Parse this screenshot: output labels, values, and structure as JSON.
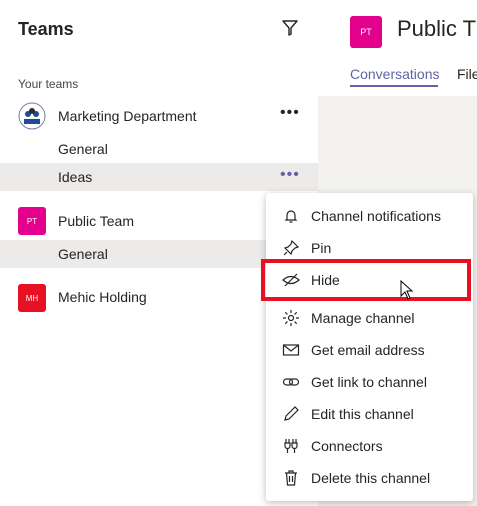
{
  "sidebar": {
    "title": "Teams",
    "section_label": "Your teams",
    "teams": [
      {
        "name": "Marketing Department",
        "channels": [
          "General",
          "Ideas"
        ]
      },
      {
        "name": "Public Team",
        "avatar_text": "PT",
        "avatar_color": "#e3008c",
        "channels": [
          "General"
        ]
      },
      {
        "name": "Mehic Holding",
        "avatar_text": "MH",
        "avatar_color": "#e81123"
      }
    ]
  },
  "header": {
    "avatar_text": "PT",
    "title": "Public T",
    "tabs": [
      "Conversations",
      "File"
    ]
  },
  "context_menu": {
    "items": [
      {
        "label": "Channel notifications",
        "icon": "bell-icon"
      },
      {
        "label": "Pin",
        "icon": "pin-icon"
      },
      {
        "label": "Hide",
        "icon": "eye-slash-icon"
      },
      {
        "label": "Manage channel",
        "icon": "gear-icon"
      },
      {
        "label": "Get email address",
        "icon": "mail-icon"
      },
      {
        "label": "Get link to channel",
        "icon": "link-icon"
      },
      {
        "label": "Edit this channel",
        "icon": "pencil-icon"
      },
      {
        "label": "Connectors",
        "icon": "connector-icon"
      },
      {
        "label": "Delete this channel",
        "icon": "trash-icon"
      }
    ]
  },
  "colors": {
    "accent": "#6264a7",
    "highlight": "#e81123"
  }
}
